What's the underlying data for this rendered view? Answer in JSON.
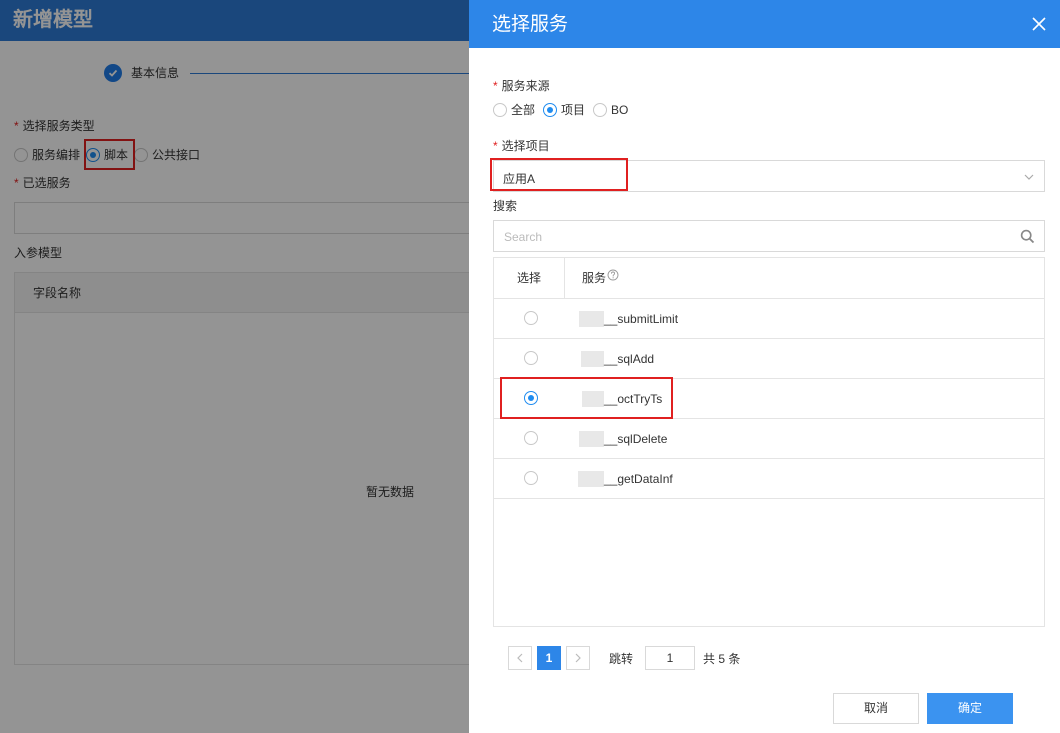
{
  "background": {
    "title": "新增模型",
    "step_label": "基本信息",
    "service_type_label": "选择服务类型",
    "service_type_options": [
      "服务编排",
      "脚本",
      "公共接口"
    ],
    "service_type_selected": "脚本",
    "selected_service_label": "已选服务",
    "input_model_label": "入参模型",
    "table_col_field": "字段名称",
    "empty_text": "暂无数据"
  },
  "drawer": {
    "title": "选择服务",
    "source_label": "服务来源",
    "source_options": [
      "全部",
      "项目",
      "BO"
    ],
    "source_selected": "项目",
    "project_label": "选择项目",
    "project_value": "应用A",
    "search_label": "搜索",
    "search_placeholder": "Search",
    "col_select": "选择",
    "col_service": "服务",
    "rows": [
      {
        "name": "__submitLimit",
        "selected": false
      },
      {
        "name": "__sqlAdd",
        "selected": false
      },
      {
        "name": "__octTryTs",
        "selected": true
      },
      {
        "name": "__sqlDelete",
        "selected": false
      },
      {
        "name": "__getDataInf",
        "selected": false
      }
    ],
    "pager": {
      "current_page": "1",
      "jump_label": "跳转",
      "jump_value": "1",
      "total_text": "共 5 条"
    },
    "cancel_label": "取消",
    "ok_label": "确定"
  },
  "colors": {
    "primary": "#2d86e8",
    "required": "#e02020",
    "highlight_box": "#e02020"
  }
}
